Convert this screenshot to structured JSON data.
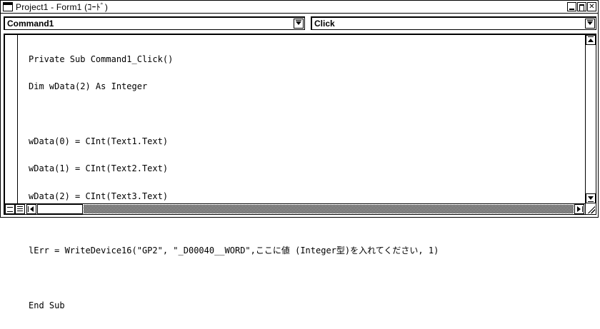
{
  "window": {
    "title": "Project1 - Form1 (ｺｰﾄﾞ)",
    "icons": {
      "system": "form-icon",
      "minimize": "minimize-icon",
      "maximize": "maximize-icon",
      "close": "close-icon"
    }
  },
  "object_combo": {
    "value": "Command1",
    "icon": "dropdown-arrow-icon"
  },
  "procedure_combo": {
    "value": "Click",
    "icon": "dropdown-arrow-icon"
  },
  "code": {
    "lines": [
      "Private Sub Command1_Click()",
      "Dim wData(2) As Integer",
      "",
      "wData(0) = CInt(Text1.Text)",
      "wData(1) = CInt(Text2.Text)",
      "wData(2) = CInt(Text3.Text)",
      "",
      "lErr = WriteDevice16(\"GP2\", \"_D00040__WORD\",ここに値 (Integer型)を入れてください, 1)",
      "",
      "End Sub"
    ]
  },
  "scrollbars": {
    "up": "scroll-up-icon",
    "down": "scroll-down-icon",
    "left": "scroll-left-icon",
    "right": "scroll-right-icon"
  },
  "view_buttons": {
    "procedure": "procedure-view-icon",
    "full": "full-module-view-icon"
  }
}
